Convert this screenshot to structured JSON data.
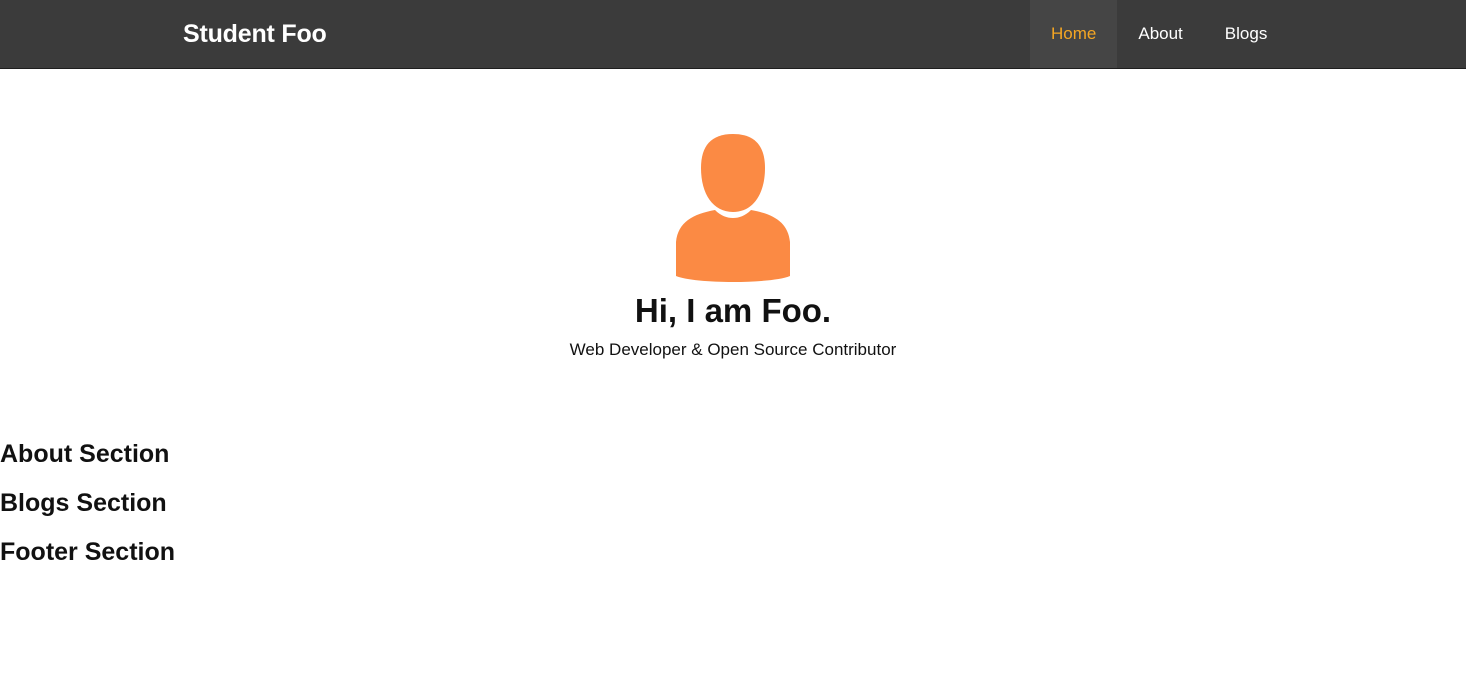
{
  "nav": {
    "brand": "Student Foo",
    "links": [
      {
        "label": "Home",
        "active": true
      },
      {
        "label": "About",
        "active": false
      },
      {
        "label": "Blogs",
        "active": false
      }
    ]
  },
  "hero": {
    "avatar_icon": "user-silhouette-icon",
    "title": "Hi, I am Foo.",
    "subtitle": "Web Developer & Open Source Contributor"
  },
  "sections": [
    {
      "heading": "About Section"
    },
    {
      "heading": "Blogs Section"
    },
    {
      "heading": "Footer Section"
    }
  ],
  "colors": {
    "navbar_bg": "#3b3b3b",
    "active_link": "#f5a623",
    "avatar": "#fb8a44"
  }
}
